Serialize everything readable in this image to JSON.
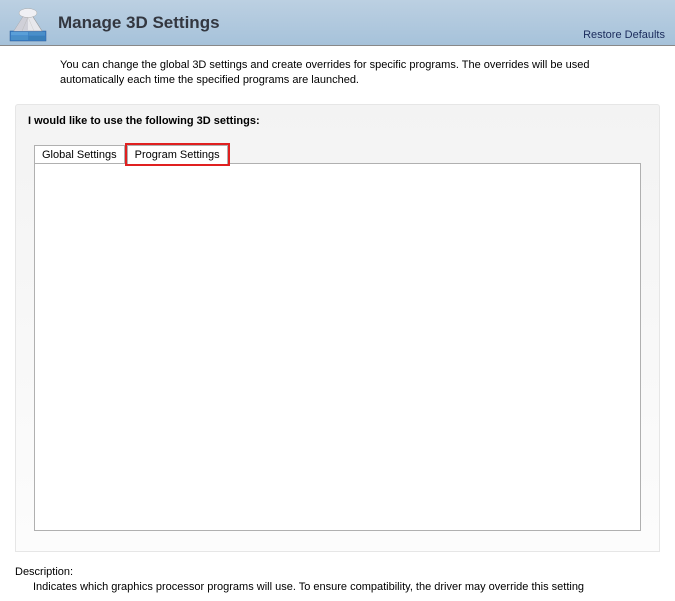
{
  "header": {
    "title": "Manage 3D Settings",
    "restore_link": "Restore Defaults"
  },
  "description": "You can change the global 3D settings and create overrides for specific programs. The overrides will be used automatically each time the specified programs are launched.",
  "panel": {
    "prompt": "I would like to use the following 3D settings:",
    "tabs": [
      {
        "label": "Global Settings"
      },
      {
        "label": "Program Settings"
      }
    ]
  },
  "footer": {
    "label": "Description:",
    "text": "Indicates which graphics processor programs will use. To ensure compatibility, the driver may override this setting"
  }
}
